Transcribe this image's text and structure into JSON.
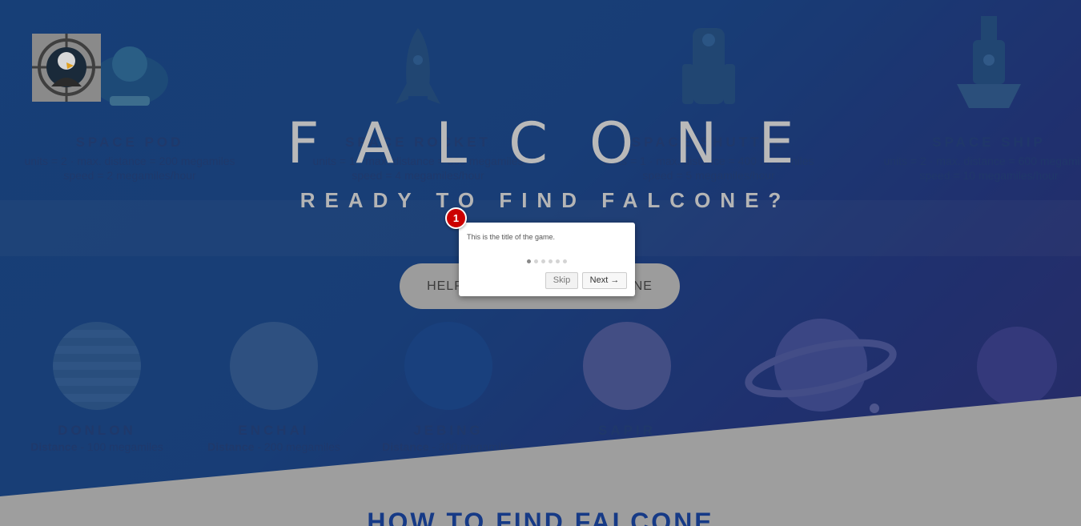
{
  "game": {
    "title": "FALCONE",
    "tagline": "READY TO FIND FALCONE?",
    "cta_label": "HELP KING SHAN FIND FALCONE",
    "how_heading": "HOW TO FIND FALCONE"
  },
  "vehicles": [
    {
      "name": "SPACE POD",
      "specs_line1": "units = 2 · max. distance = 200 megamiles",
      "specs_line2": "speed = 2 megamiles/hour"
    },
    {
      "name": "SPACE ROCKET",
      "specs_line1": "units = 1 · max. distance = 300 megamiles",
      "specs_line2": "speed = 4 megamiles/hour"
    },
    {
      "name": "SPACE SHUTTLE",
      "specs_line1": "units = 1 · max. distance = 400 megamiles",
      "specs_line2": "speed = 5 megamiles/hour"
    },
    {
      "name": "SPACE SHIP",
      "specs_line1": "units = 2 · max. distance = 600 megamiles",
      "specs_line2": "speed = 10 megamiles/hour"
    }
  ],
  "planets": [
    {
      "name": "DONLON",
      "dist_label": "Distance",
      "dist_value": " - 100 megamiles"
    },
    {
      "name": "ENCHAI",
      "dist_label": "Distance",
      "dist_value": " - 200 megamiles"
    },
    {
      "name": "JEBING",
      "dist_label": "Distance",
      "dist_value": " - 300 megamiles"
    },
    {
      "name": "SAPIR",
      "dist_label": "",
      "dist_value": ""
    }
  ],
  "tour": {
    "step_number": "1",
    "text": "This is the title of the game.",
    "skip_label": "Skip",
    "next_label": "Next →",
    "total_steps": 6,
    "current_step": 1
  },
  "colors": {
    "hero_blue": "#0b4fb6",
    "badge_red": "#cc0000",
    "heading_navy": "#163a86"
  }
}
